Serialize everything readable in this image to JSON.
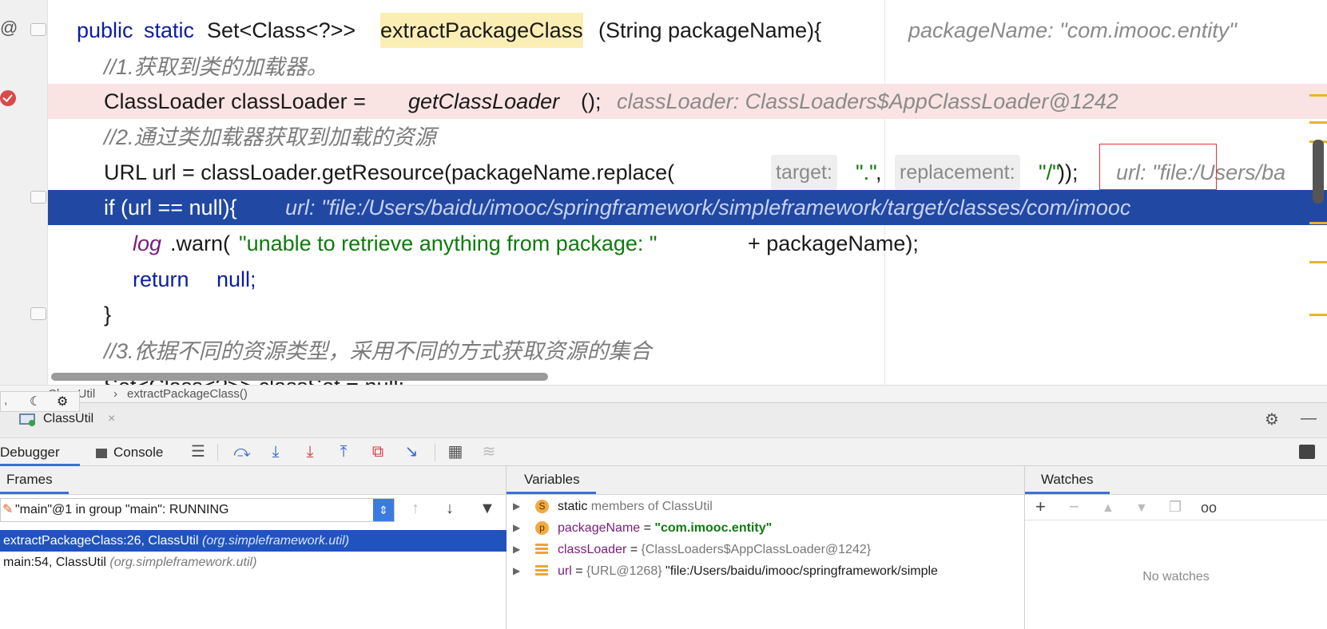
{
  "editor": {
    "gutter_symbol": "@",
    "lines": [
      {
        "parts": [
          "public",
          "static",
          "Set<Class<?>>",
          "extractPackageClass",
          "(String packageName){"
        ],
        "hint": "packageName: \"com.imooc.entity\""
      },
      {
        "comment": "//1.获取到类的加载器。"
      },
      {
        "code": "ClassLoader classLoader = ",
        "call": "getClassLoader",
        "tail": "();",
        "hint": "classLoader: ClassLoaders$AppClassLoader@1242"
      },
      {
        "comment": "//2.通过类加载器获取到加载的资源"
      },
      {
        "code": "URL url = classLoader.getResource(packageName.replace(",
        "hint1_label": "target:",
        "arg1": "\".\"",
        "sep": ",",
        "hint2_label": "replacement:",
        "arg2": "\"/\"",
        "tail": "));",
        "hint": "url: \"file:/Users/ba"
      },
      {
        "code": "if (url == null){",
        "hint": "url: \"file:/Users/baidu/imooc/springframework/simpleframework/target/classes/com/imooc"
      },
      {
        "log": "log",
        "code": ".warn(",
        "str": "\"unable to retrieve anything from package: \"",
        "tail": " + packageName);"
      },
      {
        "kw": "return",
        "tail": "null;"
      },
      {
        "code": "}"
      },
      {
        "comment": "//3.依据不同的资源类型，采用不同的方式获取资源的集合"
      },
      {
        "code": "Set<Class<?>> classSet = null;"
      }
    ]
  },
  "breadcrumb": {
    "file": "ClassUtil",
    "sep": "›",
    "method": "extractPackageClass()"
  },
  "debug": {
    "tab_label": "ClassUtil",
    "tab_close": "×",
    "tabs": {
      "debugger": "Debugger",
      "console": "Console"
    },
    "frames": {
      "title": "Frames",
      "thread": "\"main\"@1 in group \"main\": RUNNING",
      "items": [
        {
          "method": "extractPackageClass:26, ClassUtil",
          "pkg": "(org.simpleframework.util)"
        },
        {
          "method": "main:54, ClassUtil",
          "pkg": "(org.simpleframework.util)"
        }
      ]
    },
    "variables": {
      "title": "Variables",
      "items": [
        {
          "badge": "S",
          "prefix": "static",
          "rest": "members of ClassUtil"
        },
        {
          "badge": "p",
          "name": "packageName",
          "eq": "=",
          "value": "\"com.imooc.entity\""
        },
        {
          "name": "classLoader",
          "eq": "=",
          "value": "{ClassLoaders$AppClassLoader@1242}"
        },
        {
          "name": "url",
          "eq": "=",
          "ref": "{URL@1268}",
          "value": "\"file:/Users/baidu/imooc/springframework/simple"
        }
      ]
    },
    "watches": {
      "title": "Watches",
      "empty": "No watches"
    }
  },
  "colors": {
    "exec_line": "#2148a3",
    "breakpoint_line": "#fae3e3",
    "selection": "#2153bf",
    "keyword": "#0b1f9e",
    "string": "#0f7a0f"
  }
}
